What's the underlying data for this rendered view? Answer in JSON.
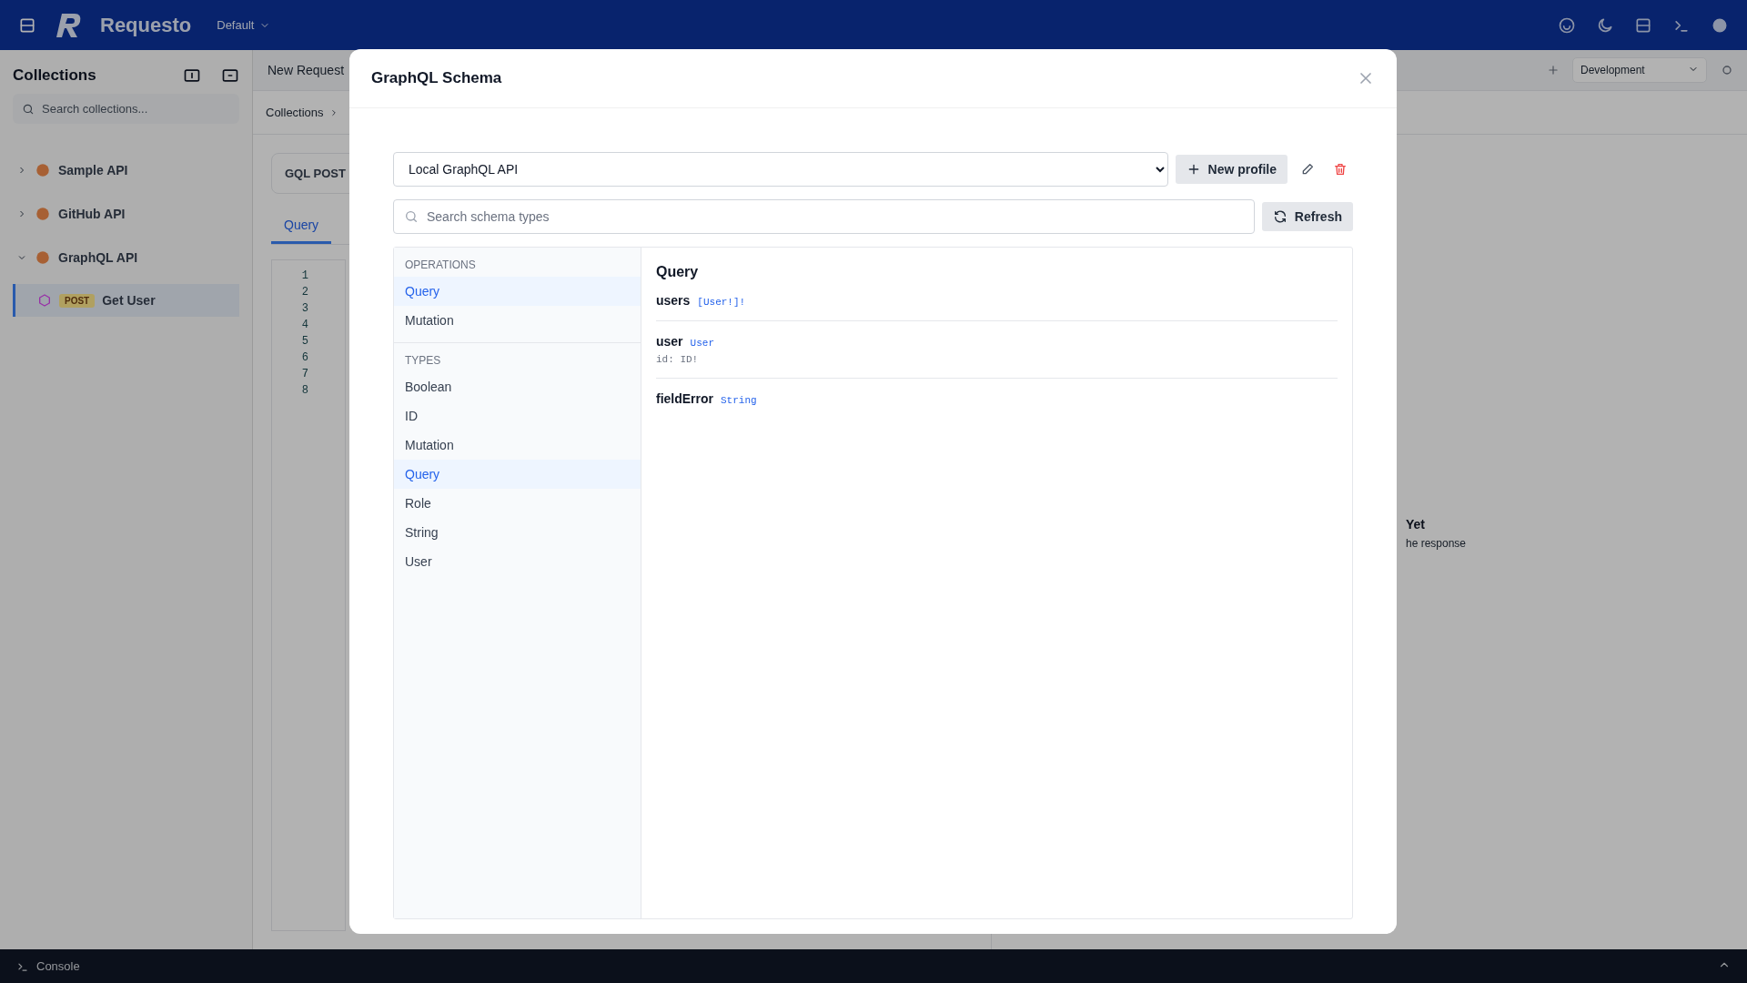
{
  "app": {
    "name": "Requesto",
    "workspace": "Default"
  },
  "sidebar": {
    "title": "Collections",
    "search_placeholder": "Search collections...",
    "collections": [
      {
        "name": "Sample API",
        "expanded": false
      },
      {
        "name": "GitHub API",
        "expanded": false
      },
      {
        "name": "GraphQL API",
        "expanded": true,
        "children": [
          {
            "method": "POST",
            "name": "Get User",
            "selected": true
          }
        ]
      }
    ]
  },
  "tabs": [
    {
      "label": "New Request"
    }
  ],
  "environment": "Development",
  "breadcrumb": "Collections",
  "request": {
    "method": "GQL POST"
  },
  "editor_tabs": [
    {
      "label": "Query",
      "selected": true
    }
  ],
  "line_numbers": [
    "1",
    "2",
    "3",
    "4",
    "5",
    "6",
    "7",
    "8"
  ],
  "response_empty": {
    "title": "Yet",
    "hint": "he response"
  },
  "console": {
    "label": "Console"
  },
  "dialog": {
    "title": "GraphQL Schema",
    "profile": "Local GraphQL API",
    "new_profile": "New profile",
    "search_placeholder": "Search schema types",
    "refresh": "Refresh",
    "sections": [
      {
        "title": "OPERATIONS",
        "items": [
          {
            "label": "Query",
            "selected": true
          },
          {
            "label": "Mutation",
            "selected": false
          }
        ]
      },
      {
        "title": "TYPES",
        "items": [
          {
            "label": "Boolean",
            "selected": false
          },
          {
            "label": "ID",
            "selected": false
          },
          {
            "label": "Mutation",
            "selected": false
          },
          {
            "label": "Query",
            "selected": true
          },
          {
            "label": "Role",
            "selected": false
          },
          {
            "label": "String",
            "selected": false
          },
          {
            "label": "User",
            "selected": false
          }
        ]
      }
    ],
    "detail": {
      "title": "Query",
      "fields": [
        {
          "name": "users",
          "type": "[User!]!"
        },
        {
          "name": "user",
          "type": "User",
          "args": [
            "id: ID!"
          ]
        },
        {
          "name": "fieldError",
          "type": "String"
        }
      ]
    }
  }
}
